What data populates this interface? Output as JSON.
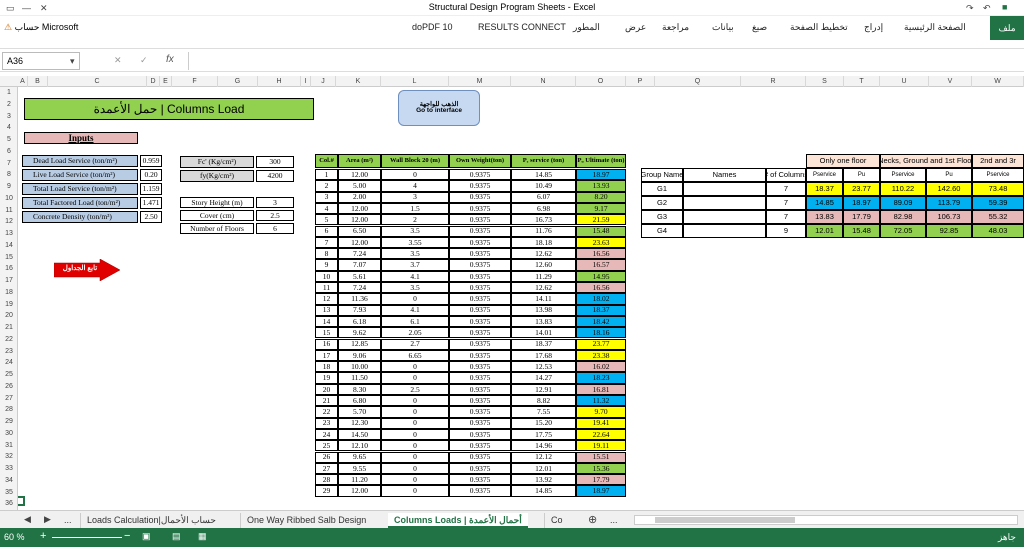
{
  "window": {
    "title": "Structural Design Program Sheets - Excel"
  },
  "account": {
    "label": "حساب Microsoft"
  },
  "ribbon": {
    "tabs": [
      "ملف",
      "الصفحة الرئيسية",
      "إدراج",
      "تخطيط الصفحة",
      "صيغ",
      "بيانات",
      "مراجعة",
      "عرض",
      "المطور",
      "RESULTS CONNECT",
      "doPDF 10"
    ]
  },
  "formula_bar": {
    "name_box": "A36",
    "fx": "fx",
    "content": ""
  },
  "columns": [
    "A",
    "B",
    "C",
    "D",
    "E",
    "F",
    "G",
    "H",
    "I",
    "J",
    "K",
    "L",
    "M",
    "N",
    "O",
    "P",
    "Q",
    "R",
    "S",
    "T",
    "U",
    "V",
    "W"
  ],
  "rows": [
    "1",
    "2",
    "3",
    "4",
    "5",
    "6",
    "7",
    "8",
    "9",
    "10",
    "11",
    "12",
    "13",
    "14",
    "15",
    "16",
    "17",
    "18",
    "19",
    "20",
    "21",
    "22",
    "23",
    "24",
    "25",
    "26",
    "27",
    "28",
    "29",
    "30",
    "31",
    "32",
    "33",
    "34",
    "35",
    "36"
  ],
  "sheet": {
    "banner_title": "حمل الأعمدة | Columns Load",
    "goto_button": {
      "line1": "الذهب للواجهة",
      "line2": "Go to interface"
    },
    "inputs_title": "Inputs",
    "next_button": "تابع الجداول",
    "loads": [
      {
        "label": "Dead Load Service (ton/m²)",
        "value": "0.959"
      },
      {
        "label": "Live Load Service (ton/m²)",
        "value": "0.20"
      },
      {
        "label": "Total Load Service (ton/m²)",
        "value": "1.159"
      },
      {
        "label": "Total Factored Load (ton/m²)",
        "value": "1.471"
      },
      {
        "label": "Concrete Density (ton/m³)",
        "value": "2.50"
      }
    ],
    "materials": [
      {
        "label": "Fc' (Kg/cm²)",
        "value": "300"
      },
      {
        "label": "fy(Kg/cm²)",
        "value": "4200"
      }
    ],
    "geometry": [
      {
        "label": "Story Height (m)",
        "value": "3"
      },
      {
        "label": "Cover (cm)",
        "value": "2.5"
      },
      {
        "label": "Number of Floors",
        "value": "6"
      }
    ],
    "col_table_headers": [
      "Col.#",
      "Area (m²)",
      "Wall Block 20 (m)",
      "Own Weight(ton)",
      "Pₑ service (ton)",
      "Pᵤ Ultimate (ton)"
    ],
    "col_rows": [
      [
        "1",
        "12.00",
        "0",
        "0.9375",
        "14.85",
        "18.97"
      ],
      [
        "2",
        "5.00",
        "4",
        "0.9375",
        "10.49",
        "13.93"
      ],
      [
        "3",
        "2.00",
        "3",
        "0.9375",
        "6.07",
        "8.20"
      ],
      [
        "4",
        "12.00",
        "1.5",
        "0.9375",
        "6.98",
        "9.17"
      ],
      [
        "5",
        "12.00",
        "2",
        "0.9375",
        "16.73",
        "21.59"
      ],
      [
        "6",
        "6.50",
        "3.5",
        "0.9375",
        "11.76",
        "15.48"
      ],
      [
        "7",
        "12.00",
        "3.55",
        "0.9375",
        "18.18",
        "23.63"
      ],
      [
        "8",
        "7.24",
        "3.5",
        "0.9375",
        "12.62",
        "16.56"
      ],
      [
        "9",
        "7.07",
        "3.7",
        "0.9375",
        "12.60",
        "16.57"
      ],
      [
        "10",
        "5.61",
        "4.1",
        "0.9375",
        "11.29",
        "14.95"
      ],
      [
        "11",
        "7.24",
        "3.5",
        "0.9375",
        "12.62",
        "16.56"
      ],
      [
        "12",
        "11.36",
        "0",
        "0.9375",
        "14.11",
        "18.02"
      ],
      [
        "13",
        "7.93",
        "4.1",
        "0.9375",
        "13.98",
        "18.37"
      ],
      [
        "14",
        "6.18",
        "6.1",
        "0.9375",
        "13.83",
        "18.42"
      ],
      [
        "15",
        "9.62",
        "2.05",
        "0.9375",
        "14.01",
        "18.16"
      ],
      [
        "16",
        "12.85",
        "2.7",
        "0.9375",
        "18.37",
        "23.77"
      ],
      [
        "17",
        "9.06",
        "6.65",
        "0.9375",
        "17.68",
        "23.38"
      ],
      [
        "18",
        "10.00",
        "0",
        "0.9375",
        "12.53",
        "16.02"
      ],
      [
        "19",
        "11.50",
        "0",
        "0.9375",
        "14.27",
        "18.23"
      ],
      [
        "20",
        "8.30",
        "2.5",
        "0.9375",
        "12.91",
        "16.81"
      ],
      [
        "21",
        "6.80",
        "0",
        "0.9375",
        "8.82",
        "11.32"
      ],
      [
        "22",
        "5.70",
        "0",
        "0.9375",
        "7.55",
        "9.70"
      ],
      [
        "23",
        "12.30",
        "0",
        "0.9375",
        "15.20",
        "19.41"
      ],
      [
        "24",
        "14.50",
        "0",
        "0.9375",
        "17.75",
        "22.64"
      ],
      [
        "25",
        "12.10",
        "0",
        "0.9375",
        "14.96",
        "19.11"
      ],
      [
        "26",
        "9.65",
        "0",
        "0.9375",
        "12.12",
        "15.51"
      ],
      [
        "27",
        "9.55",
        "0",
        "0.9375",
        "12.01",
        "15.36"
      ],
      [
        "28",
        "11.20",
        "0",
        "0.9375",
        "13.92",
        "17.79"
      ],
      [
        "29",
        "12.00",
        "0",
        "0.9375",
        "14.85",
        "18.97"
      ]
    ],
    "pu_colors": [
      "#00b0f0",
      "#92d050",
      "#92d050",
      "#92d050",
      "#ffff00",
      "#92d050",
      "#ffff00",
      "#e6b8b7",
      "#e6b8b7",
      "#92d050",
      "#e6b8b7",
      "#00b0f0",
      "#00b0f0",
      "#00b0f0",
      "#00b0f0",
      "#ffff00",
      "#ffff00",
      "#e6b8b7",
      "#00b0f0",
      "#e6b8b7",
      "#00b0f0",
      "#ffff00",
      "#ffff00",
      "#ffff00",
      "#ffff00",
      "#e6b8b7",
      "#92d050",
      "#e6b8b7",
      "#00b0f0"
    ],
    "group_table": {
      "headers": [
        "Group Name",
        "Names",
        "# of Columns"
      ],
      "band1": "Only one floor",
      "band2": "Necks, Ground and 1st Floor",
      "band3": "2nd and 3r",
      "sub": [
        "Pservice",
        "Pu",
        "Pservice",
        "Pu",
        "Pservice"
      ],
      "rows": [
        {
          "name": "G1",
          "n": "7",
          "v": [
            "18.37",
            "23.77",
            "110.22",
            "142.60",
            "73.48"
          ],
          "c": [
            "#ffff00",
            "#ffff00",
            "#ffff00",
            "#ffff00",
            "#ffff00"
          ]
        },
        {
          "name": "G2",
          "n": "7",
          "v": [
            "14.85",
            "18.97",
            "89.09",
            "113.79",
            "59.39"
          ],
          "c": [
            "#00b0f0",
            "#00b0f0",
            "#00b0f0",
            "#00b0f0",
            "#00b0f0"
          ]
        },
        {
          "name": "G3",
          "n": "7",
          "v": [
            "13.83",
            "17.79",
            "82.98",
            "106.73",
            "55.32"
          ],
          "c": [
            "#e6b8b7",
            "#e6b8b7",
            "#e6b8b7",
            "#e6b8b7",
            "#e6b8b7"
          ]
        },
        {
          "name": "G4",
          "n": "9",
          "v": [
            "12.01",
            "15.48",
            "72.05",
            "92.85",
            "48.03"
          ],
          "c": [
            "#92d050",
            "#92d050",
            "#92d050",
            "#92d050",
            "#92d050"
          ]
        }
      ]
    }
  },
  "tabs": [
    "...",
    "Loads Calculation|حساب الأحمال",
    "One Way Ribbed Salb Design",
    "Columns Loads | أحمال الأعمدة",
    "Co",
    "..."
  ],
  "status": {
    "ready": "جاهز",
    "zoom": "60 %"
  }
}
